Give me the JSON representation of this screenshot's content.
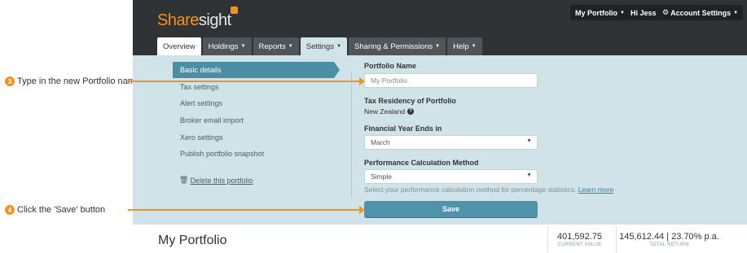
{
  "annotations": [
    {
      "number": "3",
      "text": "Type in the new Portfolio name"
    },
    {
      "number": "4",
      "text": "Click the 'Save' button"
    }
  ],
  "brand": {
    "logo_part1": "Share",
    "logo_part2": "sight",
    "accent": "#f39221"
  },
  "topbar": {
    "portfolio_menu": "My Portfolio",
    "greeting": "Hi Jess",
    "account_settings": "Account Settings"
  },
  "nav": {
    "tabs": [
      {
        "label": "Overview"
      },
      {
        "label": "Holdings"
      },
      {
        "label": "Reports"
      },
      {
        "label": "Settings"
      },
      {
        "label": "Sharing & Permissions"
      },
      {
        "label": "Help"
      }
    ]
  },
  "sidebar": {
    "items": [
      {
        "label": "Basic details"
      },
      {
        "label": "Tax settings"
      },
      {
        "label": "Alert settings"
      },
      {
        "label": "Broker email import"
      },
      {
        "label": "Xero settings"
      },
      {
        "label": "Publish portfolio snapshot"
      }
    ],
    "delete_label": "Delete this portfolio"
  },
  "form": {
    "name_label": "Portfolio Name",
    "name_placeholder": "My Portfolio",
    "tax_label": "Tax Residency of Portfolio",
    "tax_value": "New Zealand",
    "fy_label": "Financial Year Ends in",
    "fy_value": "March",
    "perf_label": "Performance Calculation Method",
    "perf_value": "Simple",
    "perf_hint": "Select your performance calculation method for percentage statistics.",
    "learn_more": "Learn more",
    "save_label": "Save"
  },
  "summary": {
    "title": "My Portfolio",
    "current_value": "401,592.75",
    "current_value_label": "CURRENT VALUE",
    "total_return": "145,612.44 | 23.70% p.a.",
    "total_return_label": "TOTAL RETURN"
  }
}
